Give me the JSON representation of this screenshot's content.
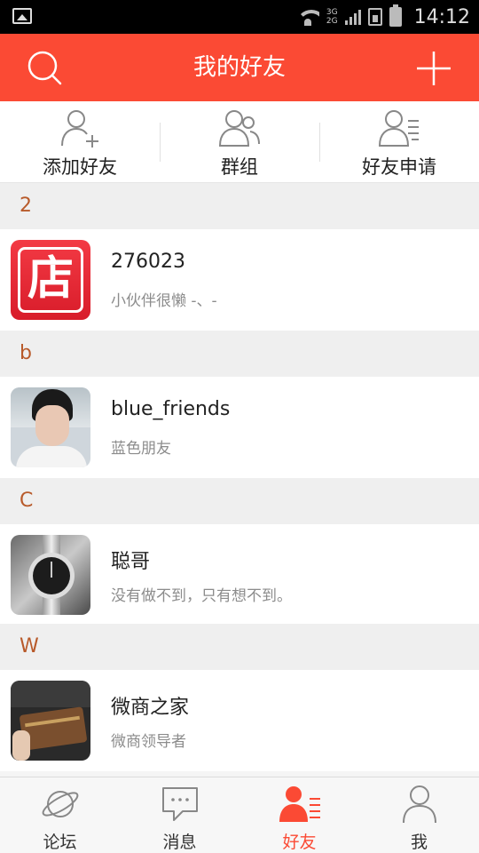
{
  "status_bar": {
    "time": "14:12",
    "net_top": "3G",
    "net_bottom": "2G"
  },
  "header": {
    "title": "我的好友"
  },
  "actions": [
    {
      "label": "添加好友",
      "icon": "add-friend-icon"
    },
    {
      "label": "群组",
      "icon": "group-icon"
    },
    {
      "label": "好友申请",
      "icon": "friend-request-icon"
    }
  ],
  "sections": [
    {
      "letter": "2",
      "friend": {
        "name": "276023",
        "desc": "小伙伴很懒 -、-",
        "avatar": "shop-logo-avatar"
      }
    },
    {
      "letter": "b",
      "friend": {
        "name": "blue_friends",
        "desc": "蓝色朋友",
        "avatar": "photo-avatar-boy"
      }
    },
    {
      "letter": "C",
      "friend": {
        "name": "聪哥",
        "desc": "没有做不到，只有想不到。",
        "avatar": "photo-avatar-watch"
      }
    },
    {
      "letter": "W",
      "friend": {
        "name": "微商之家",
        "desc": "微商领导者",
        "avatar": "photo-avatar-bag"
      }
    }
  ],
  "avatar_text": {
    "shop_logo_char": "店"
  },
  "tabs": [
    {
      "label": "论坛",
      "icon": "planet-icon",
      "active": false
    },
    {
      "label": "消息",
      "icon": "chat-bubble-icon",
      "active": false
    },
    {
      "label": "好友",
      "icon": "friends-icon",
      "active": true
    },
    {
      "label": "我",
      "icon": "person-icon",
      "active": false
    }
  ],
  "colors": {
    "accent": "#fb4a34",
    "section_letter": "#b85a2a"
  }
}
